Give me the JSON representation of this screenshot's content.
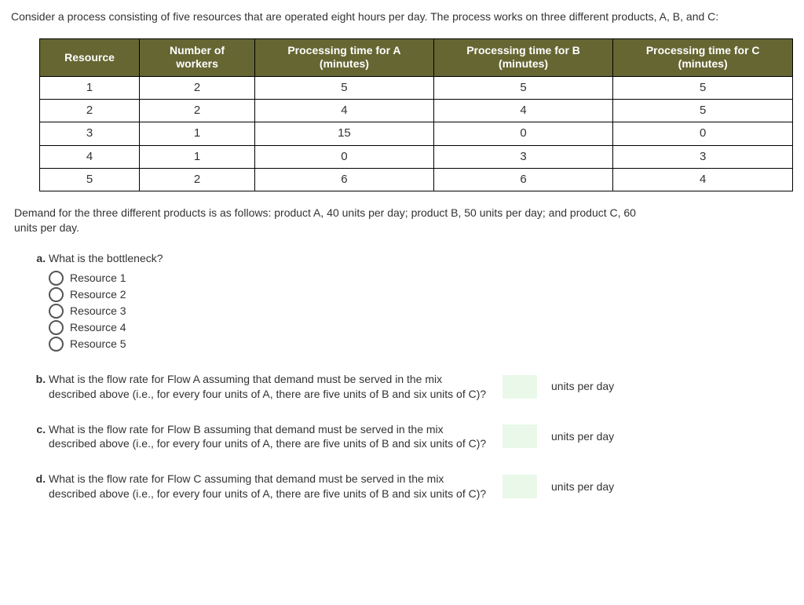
{
  "intro": "Consider a process consisting of five resources that are operated eight hours per day. The process works on three different products, A, B, and C:",
  "table": {
    "headers": [
      "Resource",
      "Number of workers",
      "Processing time for A (minutes)",
      "Processing time for B (minutes)",
      "Processing time for C (minutes)"
    ],
    "rows": [
      [
        "1",
        "2",
        "5",
        "5",
        "5"
      ],
      [
        "2",
        "2",
        "4",
        "4",
        "5"
      ],
      [
        "3",
        "1",
        "15",
        "0",
        "0"
      ],
      [
        "4",
        "1",
        "0",
        "3",
        "3"
      ],
      [
        "5",
        "2",
        "6",
        "6",
        "4"
      ]
    ]
  },
  "demand": "Demand for the three different products is as follows: product A, 40 units per day; product B, 50 units per day; and product C, 60 units per day.",
  "qa": {
    "prompt": "What is the bottleneck?",
    "options": [
      "Resource 1",
      "Resource 2",
      "Resource 3",
      "Resource 4",
      "Resource 5"
    ]
  },
  "qb": {
    "text": "What is the flow rate for Flow A assuming that demand must be served in the mix described above (i.e., for every four units of A, there are five units of B and six units of C)?",
    "unit": "units per day"
  },
  "qc": {
    "text": "What is the flow rate for Flow B assuming that demand must be served in the mix described above (i.e., for every four units of A, there are five units of B and six units of C)?",
    "unit": "units per day"
  },
  "qd": {
    "text": "What is the flow rate for Flow C assuming that demand must be served in the mix described above (i.e., for every four units of A, there are five units of B and six units of C)?",
    "unit": "units per day"
  },
  "chart_data": {
    "type": "table",
    "columns": [
      "Resource",
      "Number of workers",
      "Processing time for A (minutes)",
      "Processing time for B (minutes)",
      "Processing time for C (minutes)"
    ],
    "rows": [
      [
        1,
        2,
        5,
        5,
        5
      ],
      [
        2,
        2,
        4,
        4,
        5
      ],
      [
        3,
        1,
        15,
        0,
        0
      ],
      [
        4,
        1,
        0,
        3,
        3
      ],
      [
        5,
        2,
        6,
        6,
        4
      ]
    ]
  }
}
